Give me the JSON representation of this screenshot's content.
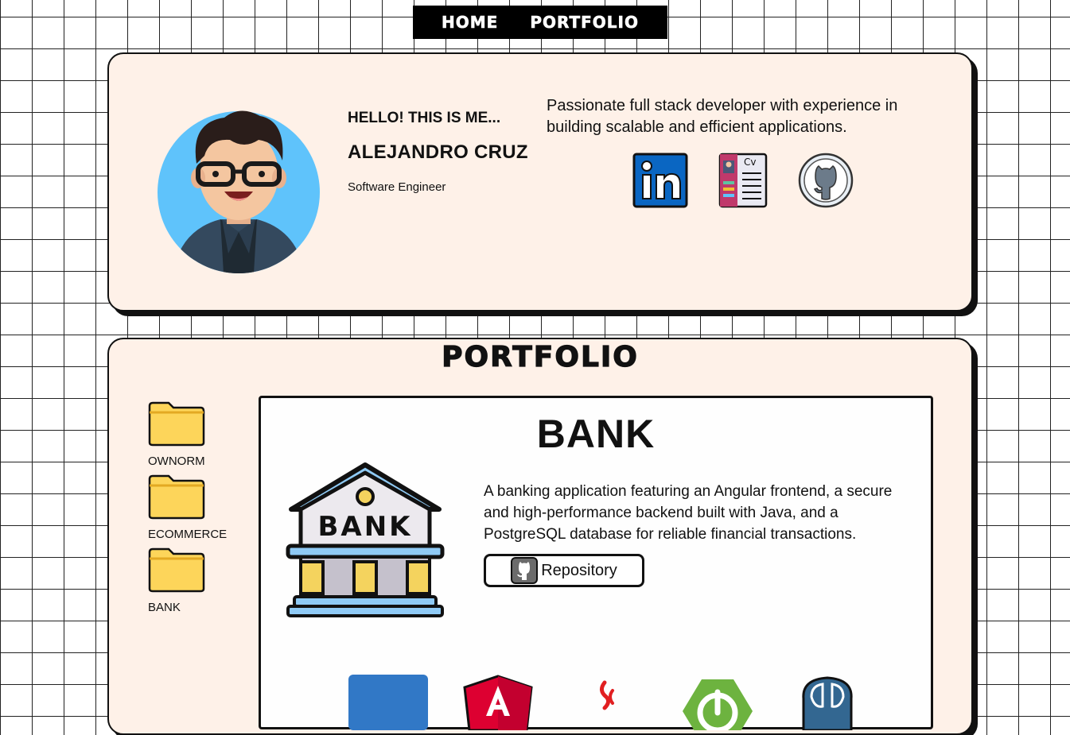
{
  "nav": {
    "home": "HOME",
    "portfolio": "PORTFOLIO"
  },
  "profile": {
    "greeting": "HELLO! THIS IS ME...",
    "name": "ALEJANDRO CRUZ",
    "role": "Software Engineer",
    "bio": "Passionate full stack developer with experience in building scalable and efficient applications.",
    "social": [
      "linkedin-icon",
      "cv-icon",
      "github-icon"
    ]
  },
  "portfolio": {
    "title": "PORTFOLIO",
    "folders": [
      {
        "label": "OWNORM"
      },
      {
        "label": "ECOMMERCE"
      },
      {
        "label": "BANK"
      }
    ],
    "project": {
      "title": "BANK",
      "illustration_text": "BANK",
      "description": "A banking application featuring an Angular frontend, a secure and high-performance backend built with Java, and a PostgreSQL database for reliable financial transactions.",
      "repo_label": "Repository",
      "tech": [
        "typescript-icon",
        "angular-icon",
        "java-icon",
        "spring-boot-icon",
        "postgresql-icon"
      ]
    }
  },
  "colors": {
    "card_bg": "#fef1e8",
    "folder": "#fdd55a",
    "avatar_bg": "#5fc3fb",
    "linkedin": "#0a66c2",
    "angular": "#dd0031",
    "spring": "#6db33f",
    "postgres": "#336791"
  }
}
